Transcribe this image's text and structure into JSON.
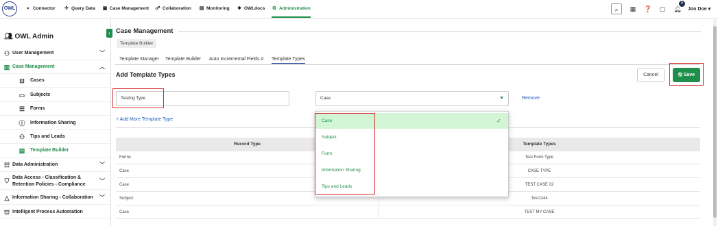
{
  "app": {
    "logo_text": "OWL"
  },
  "topnav": {
    "items": [
      {
        "label": "Connector",
        "icon": "search-icon"
      },
      {
        "label": "Query Data",
        "icon": "move-icon"
      },
      {
        "label": "Case Management",
        "icon": "folder-icon"
      },
      {
        "label": "Collaboration",
        "icon": "people-icon"
      },
      {
        "label": "Monitoring",
        "icon": "monitor-icon"
      },
      {
        "label": "OWLdocs",
        "icon": "docs-icon"
      },
      {
        "label": "Administration",
        "icon": "admin-icon",
        "active": true
      }
    ],
    "notification_count": "9",
    "user_name": "Jon Doe"
  },
  "sidebar": {
    "title": "OWL Admin",
    "items": [
      {
        "label": "User Management",
        "icon": "users-icon"
      },
      {
        "label": "Case Management",
        "icon": "books-icon"
      },
      {
        "label": "Cases",
        "icon": "briefcase-icon"
      },
      {
        "label": "Subjects",
        "icon": "folder-icon"
      },
      {
        "label": "Forms",
        "icon": "form-icon"
      },
      {
        "label": "Information Sharing",
        "icon": "info-icon"
      },
      {
        "label": "Tips and Leads",
        "icon": "people-icon"
      },
      {
        "label": "Template Builder",
        "icon": "template-icon"
      },
      {
        "label": "Data Administration",
        "icon": "database-icon"
      },
      {
        "label_line1": "Data Access - Classification &",
        "label_line2": "Retention Policies - Compliance",
        "icon": "shield-icon"
      },
      {
        "label": "Information Sharing - Collaboration",
        "icon": "share-icon"
      },
      {
        "label": "Intelligent Process Automation",
        "icon": "automation-icon"
      }
    ]
  },
  "main": {
    "title": "Case Management",
    "breadcrumb": "Template Builder",
    "tabs": [
      "Template Manager",
      "Template Builder",
      "Auto Incremental Fields #",
      "Template Types"
    ],
    "section_title": "Add Template Types",
    "cancel_label": "Cancel",
    "save_label": "Save",
    "type_input_value": "Testing Type",
    "record_select_value": "Case",
    "remove_label": "Remove",
    "add_more_label": "+ Add More Template Type",
    "dropdown_options": [
      "Case",
      "Subject",
      "Form",
      "Information Sharing",
      "Tips and Leads"
    ],
    "table": {
      "headers": [
        "Record Type",
        "Template Types"
      ],
      "rows": [
        [
          "Forms",
          "Test Form Type"
        ],
        [
          "Case",
          "CASE TYPE"
        ],
        [
          "Case",
          "TEST CASE 02"
        ],
        [
          "Subject",
          "Test1244"
        ],
        [
          "Case",
          "TEST MY CASE"
        ]
      ]
    }
  },
  "colors": {
    "accent": "#1e8e4a",
    "highlight": "#d32f2f",
    "link": "#1f5fbf"
  }
}
